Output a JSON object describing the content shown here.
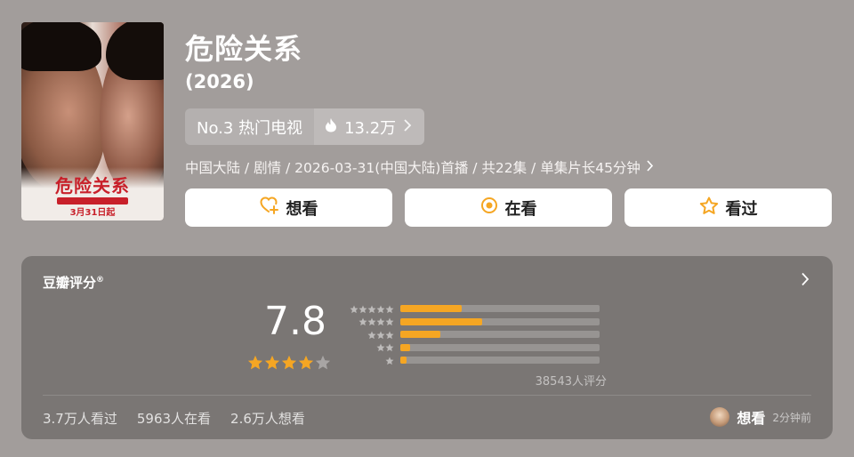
{
  "poster": {
    "title": "危险关系",
    "date": "3月31日起"
  },
  "show": {
    "title": "危险关系",
    "year": "(2026)"
  },
  "ranking": {
    "label": "No.3 热门电视",
    "heat": "13.2万"
  },
  "meta": {
    "text": "中国大陆 / 剧情 / 2026-03-31(中国大陆)首播 / 共22集 / 单集片长45分钟"
  },
  "actions": {
    "want": "想看",
    "watching": "在看",
    "watched": "看过"
  },
  "colors": {
    "accent": "#f5a623",
    "background": "#a29d9b"
  },
  "rating": {
    "section_title": "豆瓣评分",
    "section_mark": "®",
    "score": "7.8",
    "stars_filled": 4,
    "stars_total": 5,
    "distribution": [
      {
        "stars": 5,
        "fraction": 0.31
      },
      {
        "stars": 4,
        "fraction": 0.41
      },
      {
        "stars": 3,
        "fraction": 0.2
      },
      {
        "stars": 2,
        "fraction": 0.05
      },
      {
        "stars": 1,
        "fraction": 0.03
      }
    ],
    "votes": "38543人评分"
  },
  "stats": {
    "watched": "3.7万人看过",
    "watching": "5963人在看",
    "want": "2.6万人想看"
  },
  "user_status": {
    "label": "想看",
    "time": "2分钟前"
  }
}
